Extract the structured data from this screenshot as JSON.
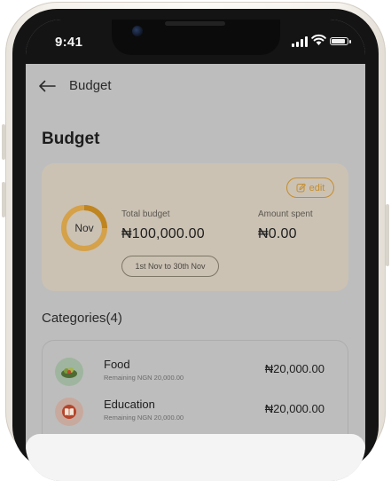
{
  "status_bar": {
    "time": "9:41"
  },
  "header": {
    "title": "Budget"
  },
  "page": {
    "title": "Budget"
  },
  "budget_card": {
    "edit_label": "edit",
    "month_label": "Nov",
    "total_label": "Total budget",
    "total_value": "₦100,000.00",
    "spent_label": "Amount spent",
    "spent_value": "₦0.00",
    "date_range": "1st Nov to 30th Nov"
  },
  "categories": {
    "heading": "Categories(4)",
    "items": [
      {
        "name": "Food",
        "remaining": "Remaining NGN 20,000.00",
        "amount": "₦20,000.00",
        "icon": "food-bowl-icon"
      },
      {
        "name": "Education",
        "remaining": "Remaining NGN 20,000.00",
        "amount": "₦20,000.00",
        "icon": "book-icon"
      }
    ]
  },
  "colors": {
    "accent": "#c58d2c",
    "card_background": "#cbc2b4",
    "overlay_screen": "#bdbdbd"
  }
}
